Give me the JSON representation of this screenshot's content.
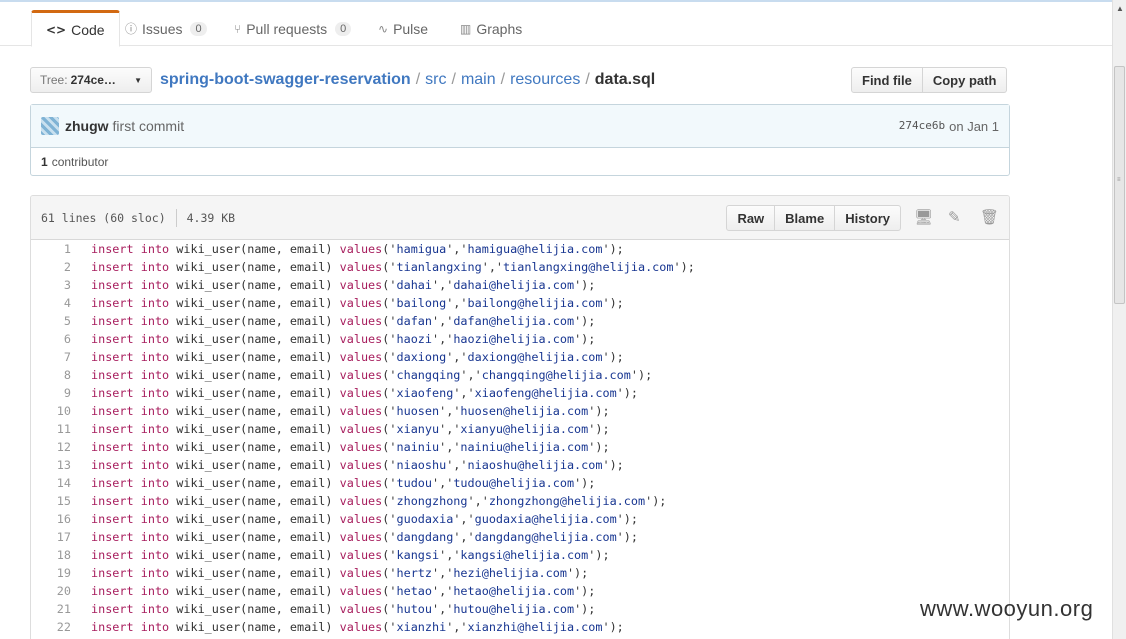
{
  "tabs": [
    {
      "label": "Code",
      "icon": "<>",
      "active": true
    },
    {
      "label": "Issues",
      "icon": "ⓘ",
      "count": "0"
    },
    {
      "label": "Pull requests",
      "icon": "⑂",
      "count": "0"
    },
    {
      "label": "Pulse",
      "icon": "∿"
    },
    {
      "label": "Graphs",
      "icon": "▥"
    }
  ],
  "branch": {
    "label": "Tree:",
    "value": "274ce…"
  },
  "breadcrumb": {
    "repo": "spring-boot-swagger-reservation",
    "parts": [
      "src",
      "main",
      "resources"
    ],
    "file": "data.sql",
    "separator": "/"
  },
  "file_nav": {
    "find_file": "Find file",
    "copy_path": "Copy path"
  },
  "commit": {
    "author": "zhugw",
    "message": "first commit",
    "sha": "274ce6b",
    "date": "on Jan 1",
    "contributors_count": "1",
    "contributors_label": "contributor"
  },
  "file": {
    "lines_info": "61 lines (60 sloc)",
    "size": "4.39 KB",
    "raw": "Raw",
    "blame": "Blame",
    "history": "History"
  },
  "code_lines": [
    {
      "n": "1",
      "name": "hamigua",
      "email": "hamigua@helijia.com"
    },
    {
      "n": "2",
      "name": "tianlangxing",
      "email": "tianlangxing@helijia.com"
    },
    {
      "n": "3",
      "name": "dahai",
      "email": "dahai@helijia.com"
    },
    {
      "n": "4",
      "name": "bailong",
      "email": "bailong@helijia.com"
    },
    {
      "n": "5",
      "name": "dafan",
      "email": "dafan@helijia.com"
    },
    {
      "n": "6",
      "name": "haozi",
      "email": "haozi@helijia.com"
    },
    {
      "n": "7",
      "name": "daxiong",
      "email": "daxiong@helijia.com"
    },
    {
      "n": "8",
      "name": "changqing",
      "email": "changqing@helijia.com"
    },
    {
      "n": "9",
      "name": "xiaofeng",
      "email": "xiaofeng@helijia.com"
    },
    {
      "n": "10",
      "name": "huosen",
      "email": "huosen@helijia.com"
    },
    {
      "n": "11",
      "name": "xianyu",
      "email": "xianyu@helijia.com"
    },
    {
      "n": "12",
      "name": "nainiu",
      "email": "nainiu@helijia.com"
    },
    {
      "n": "13",
      "name": "niaoshu",
      "email": "niaoshu@helijia.com"
    },
    {
      "n": "14",
      "name": "tudou",
      "email": "tudou@helijia.com"
    },
    {
      "n": "15",
      "name": "zhongzhong",
      "email": "zhongzhong@helijia.com"
    },
    {
      "n": "16",
      "name": "guodaxia",
      "email": "guodaxia@helijia.com"
    },
    {
      "n": "17",
      "name": "dangdang",
      "email": "dangdang@helijia.com"
    },
    {
      "n": "18",
      "name": "kangsi",
      "email": "kangsi@helijia.com"
    },
    {
      "n": "19",
      "name": "hertz",
      "email": "hezi@helijia.com"
    },
    {
      "n": "20",
      "name": "hetao",
      "email": "hetao@helijia.com"
    },
    {
      "n": "21",
      "name": "hutou",
      "email": "hutou@helijia.com"
    },
    {
      "n": "22",
      "name": "xianzhi",
      "email": "xianzhi@helijia.com"
    }
  ],
  "code_tokens": {
    "kw1": "insert",
    "kw2": "into",
    "table": "wiki_user(name, email)",
    "kw3": "values"
  },
  "watermark": "www.wooyun.org",
  "colors": {
    "accent_tab": "#d26911",
    "link": "#4078c0",
    "keyword": "#a71d5d",
    "string": "#183691"
  }
}
